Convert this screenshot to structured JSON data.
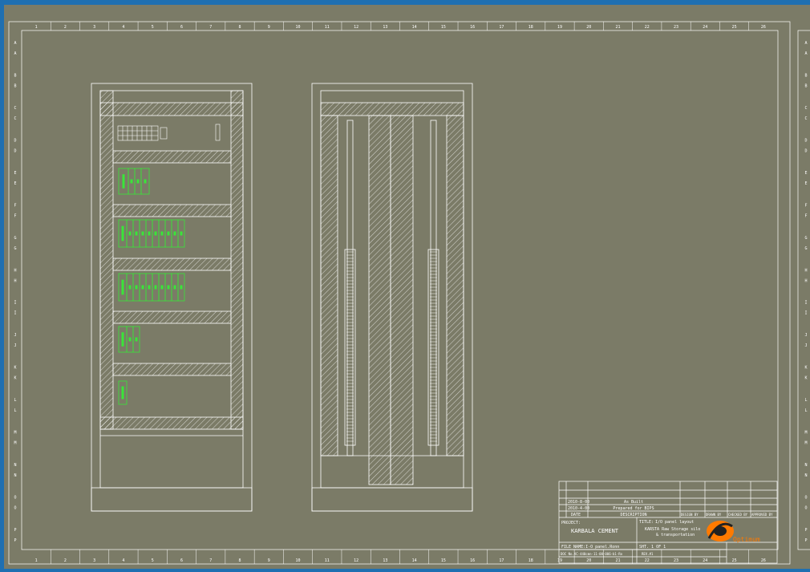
{
  "colors": {
    "canvas": "#7b7b67",
    "frame": "#1f6fb1",
    "line": "#ffffff",
    "device": "#39e639",
    "logo": "#ff7a00"
  },
  "border": {
    "columns": [
      "1",
      "2",
      "3",
      "4",
      "5",
      "6",
      "7",
      "8",
      "9",
      "10",
      "11",
      "12",
      "13",
      "14",
      "15",
      "16",
      "17",
      "18",
      "19",
      "20",
      "21",
      "22",
      "23",
      "24",
      "25",
      "26"
    ],
    "rows": [
      "A",
      "B",
      "C",
      "D",
      "E",
      "F",
      "G",
      "H",
      "I",
      "J",
      "K",
      "L",
      "M",
      "N",
      "O",
      "P"
    ]
  },
  "title_block": {
    "revisions": [
      {
        "rev": "1",
        "date": "2010-8-00",
        "description": "As Built"
      },
      {
        "rev": "0",
        "date": "2010-4-00",
        "description": "Prepared for BIPS"
      }
    ],
    "header": {
      "date": "DATE",
      "description": "DESCRIPTION",
      "design_by": "DESIGN BY",
      "drawn_by": "DRAWN BY",
      "checked_by": "CHECKED BY",
      "approved_by": "APPROVED BY"
    },
    "project_label": "PROJECT:",
    "project_name": "KARBALA CEMENT",
    "title_label": "TITLE:",
    "title_line1": "I/O panel layout",
    "title_line2": "KARSTA Raw Storage silo",
    "title_line3": "& transportation",
    "file_name": "FILE NAME:I-O panel.Ronn",
    "sheet": "SHT. 1 OF 1",
    "doc_no": "DOC No.KC-440cmn-11-00-006-b1-Ro",
    "rev_label": "REV.#1",
    "logo_text": "Optimum"
  }
}
